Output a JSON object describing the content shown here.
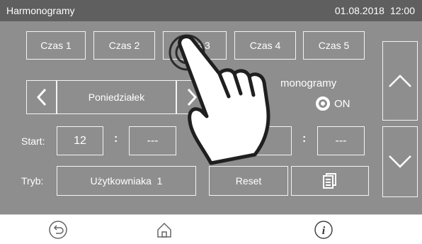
{
  "header": {
    "title": "Harmonogramy",
    "date": "01.08.2018",
    "time": "12:00"
  },
  "time_slots": [
    {
      "label": "Czas 1"
    },
    {
      "label": "Czas 2"
    },
    {
      "label": "Czas 3"
    },
    {
      "label": "Czas 4"
    },
    {
      "label": "Czas 5"
    }
  ],
  "day_selector": {
    "day": "Poniedziałek",
    "prev_icon": "chevron-left-icon",
    "next_icon": "chevron-right-icon"
  },
  "schedule_toggle": {
    "label": "Harmonogramy",
    "visible_label_fragment": "monogramy",
    "state": "ON"
  },
  "start": {
    "label": "Start:",
    "hour": "12",
    "separator": ":",
    "minute": "---"
  },
  "stop": {
    "hour": "",
    "separator": ":",
    "minute": "---"
  },
  "mode": {
    "label": "Tryb:",
    "value": "Użytkowniaka  1"
  },
  "actions": {
    "reset": "Reset",
    "copy_icon": "copy-document-icon"
  },
  "side_nav": {
    "up_icon": "chevron-up-icon",
    "down_icon": "chevron-down-icon"
  },
  "footer": {
    "back_icon": "back-arrow-icon",
    "home_icon": "home-icon",
    "info_icon": "info-icon"
  },
  "colors": {
    "screen_background": "#8e8e8e",
    "title_bar": "#5f5f5f",
    "border": "#f4f4f4",
    "text": "#ffffff"
  },
  "overlay": {
    "icon": "pointing-hand-icon",
    "tapped_item": "Czas 3"
  }
}
